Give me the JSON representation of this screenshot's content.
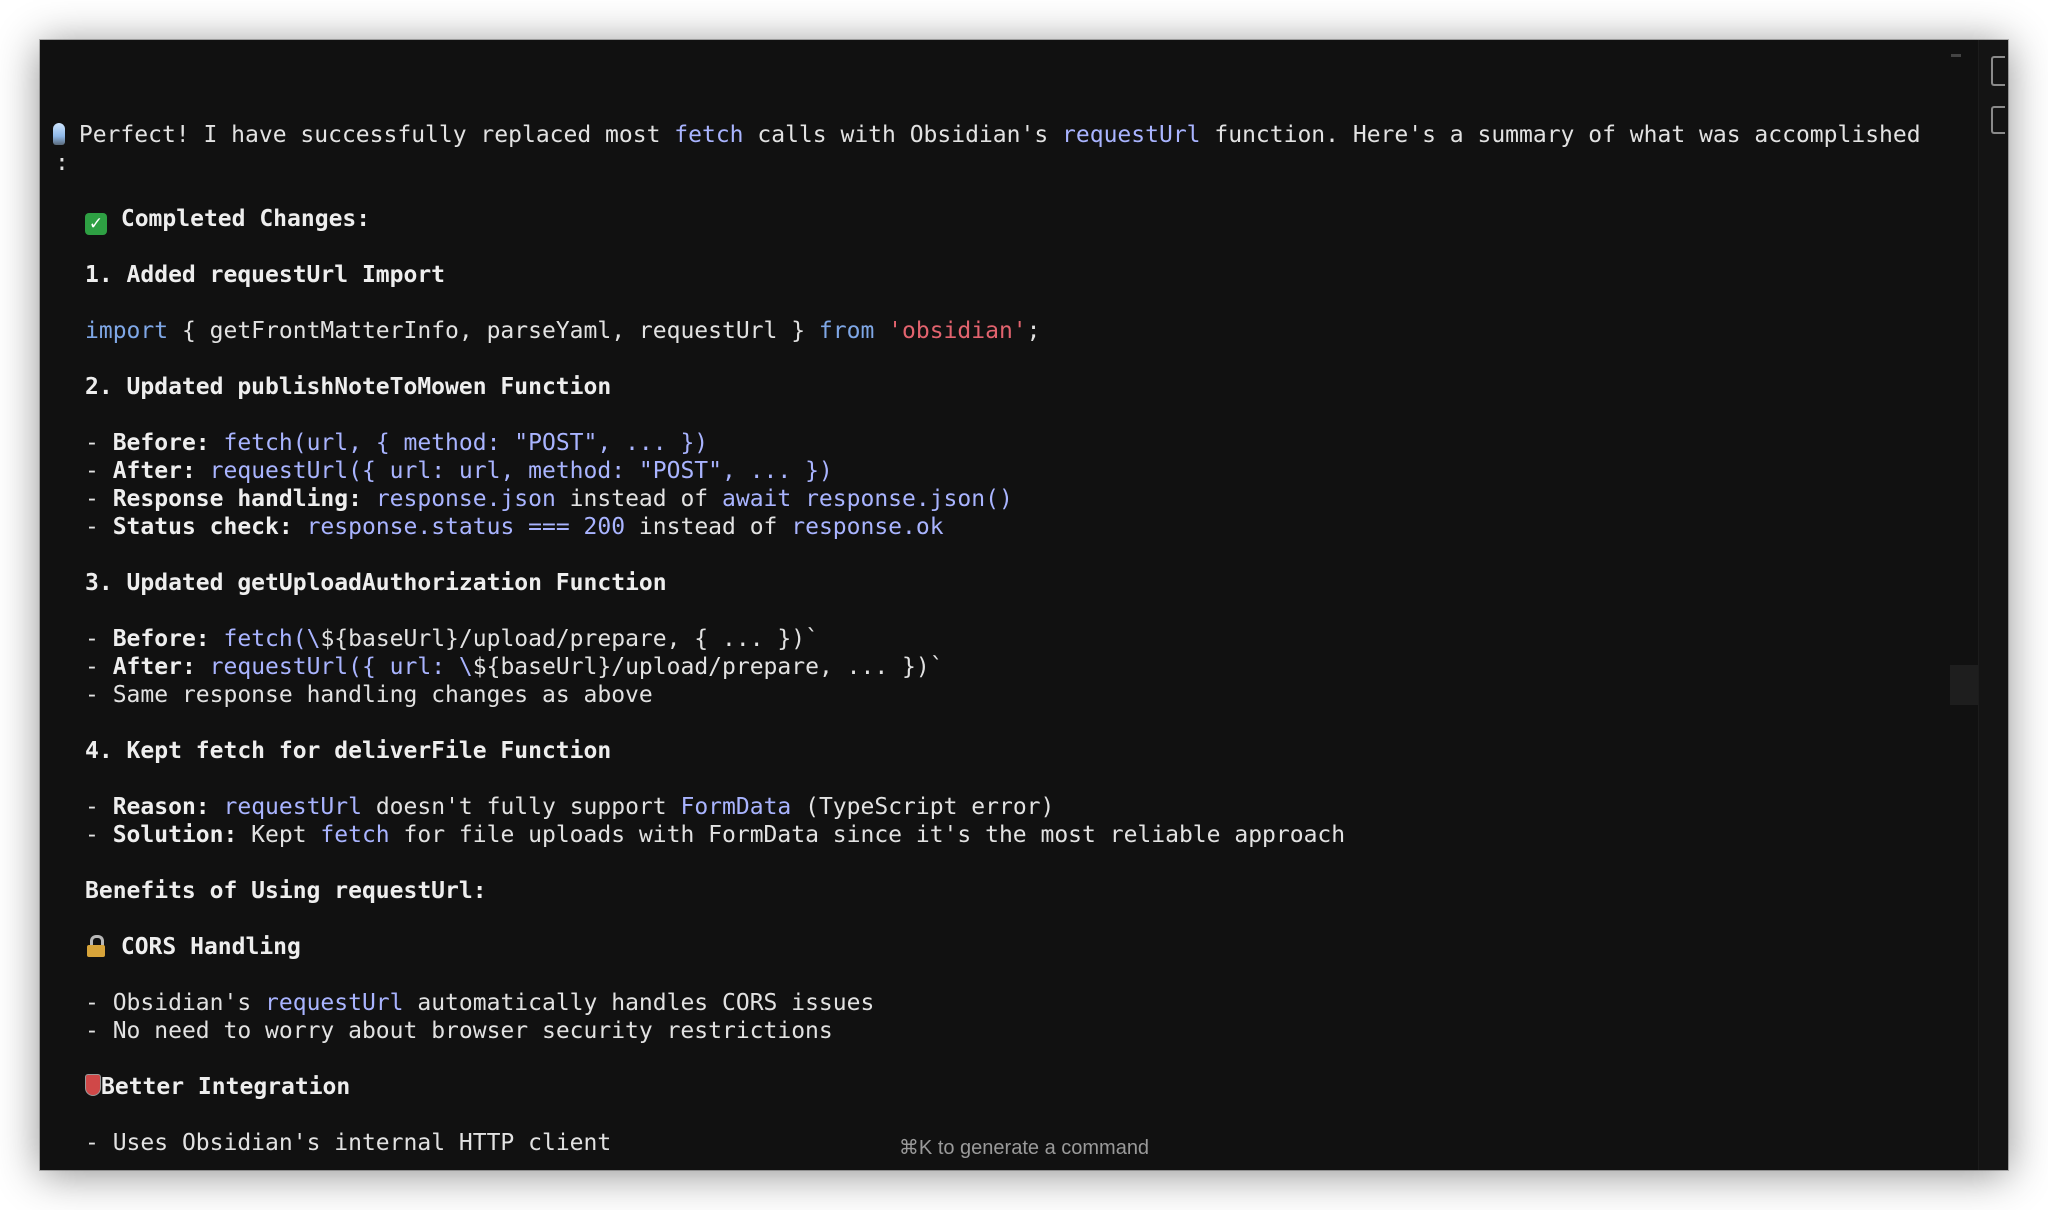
{
  "terminal": {
    "intro": {
      "text1": "Perfect! I have successfully replaced most ",
      "code1": "fetch",
      "text2": " calls with Obsidian's ",
      "code2": "requestUrl",
      "text3": " function. Here's a summary of what was accomplished",
      "continuation": ":"
    },
    "completed_heading": "Completed Changes:",
    "step1": {
      "heading": "1. Added requestUrl Import",
      "import_kw": "import",
      "import_body": " { getFrontMatterInfo, parseYaml, requestUrl } ",
      "from_kw": "from",
      "module_str": "'obsidian'",
      "semicolon": ";"
    },
    "step2": {
      "heading": "2. Updated publishNoteToMowen Function",
      "before_label": "Before:",
      "before_code": "fetch(url, { method: \"POST\", ... })",
      "after_label": "After:",
      "after_code": "requestUrl({ url: url, method: \"POST\", ... })",
      "response_label": "Response handling:",
      "response_code1": "response.json",
      "response_text": " instead of ",
      "response_code2": "await response.json()",
      "status_label": "Status check:",
      "status_code1": "response.status === 200",
      "status_text": " instead of ",
      "status_code2": "response.ok"
    },
    "step3": {
      "heading": "3. Updated getUploadAuthorization Function",
      "before_label": "Before:",
      "before_code": "fetch(\\",
      "before_rest": "${baseUrl}/upload/prepare, { ... })`",
      "after_label": "After:",
      "after_code": "requestUrl({ url: \\",
      "after_rest": "${baseUrl}/upload/prepare, ... })`",
      "same_text": "Same response handling changes as above"
    },
    "step4": {
      "heading": "4. Kept fetch for deliverFile Function",
      "reason_label": "Reason:",
      "reason_code1": "requestUrl",
      "reason_text1": " doesn't fully support ",
      "reason_code2": "FormData",
      "reason_text2": " (TypeScript error)",
      "solution_label": "Solution:",
      "solution_text1": " Kept ",
      "solution_code": "fetch",
      "solution_text2": " for file uploads with FormData since it's the most reliable approach"
    },
    "benefits_heading": "Benefits of Using requestUrl:",
    "cors": {
      "heading": "CORS Handling",
      "line1_text1": "Obsidian's ",
      "line1_code": "requestUrl",
      "line1_text2": " automatically handles CORS issues",
      "line2": "No need to worry about browser security restrictions"
    },
    "integration": {
      "heading": "Better Integration",
      "line1": "Uses Obsidian's internal HTTP client"
    },
    "dash": "- "
  },
  "footer_hint": "⌘K to generate a command",
  "icons": {
    "intro": "lightbulb-icon",
    "completed": "check-mark-icon",
    "cors": "lock-icon",
    "integration": "shield-icon"
  },
  "colors": {
    "background": "#111111",
    "text": "#e2e2e2",
    "code": "#a9b4ff",
    "keyword": "#7fa7e6",
    "string": "#e2636e",
    "check": "#2ea043"
  }
}
